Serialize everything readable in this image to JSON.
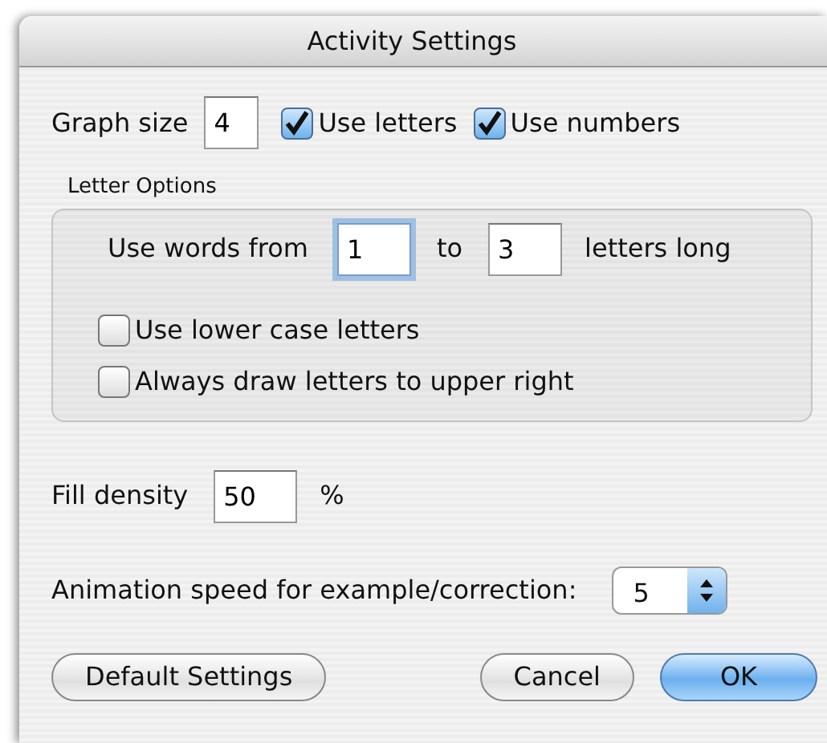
{
  "window": {
    "title": "Activity Settings"
  },
  "graph_size": {
    "label": "Graph size",
    "value": "4"
  },
  "top_checkboxes": [
    {
      "label": "Use letters",
      "checked": true
    },
    {
      "label": "Use numbers",
      "checked": true
    }
  ],
  "letter_options": {
    "title": "Letter Options",
    "range": {
      "prefix": "Use words from",
      "from": {
        "value": "1",
        "focused": true
      },
      "middle": "to",
      "to": {
        "value": "3",
        "focused": false
      },
      "suffix": "letters long"
    },
    "checkboxes": [
      {
        "label": "Use lower case letters",
        "checked": false
      },
      {
        "label": "Always draw letters to upper right",
        "checked": false
      }
    ]
  },
  "fill_density": {
    "label": "Fill density",
    "value": "50",
    "unit": "%"
  },
  "animation_speed": {
    "label": "Animation speed for example/correction:",
    "value": "5"
  },
  "left_buttons": [
    {
      "label": "Default Settings",
      "primary": false
    }
  ],
  "right_buttons": [
    {
      "label": "Cancel",
      "primary": false
    },
    {
      "label": "OK",
      "primary": true
    }
  ]
}
